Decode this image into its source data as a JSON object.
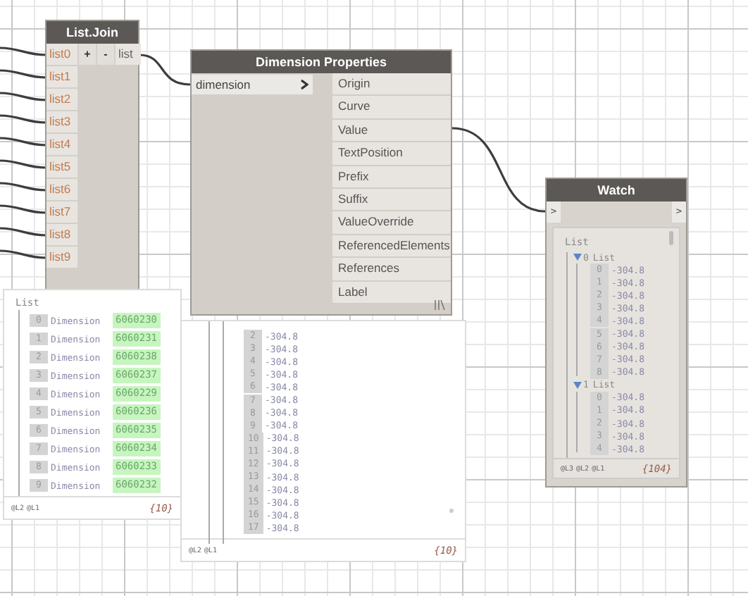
{
  "list_join": {
    "title": "List.Join",
    "inputs": [
      "list0",
      "list1",
      "list2",
      "list3",
      "list4",
      "list5",
      "list6",
      "list7",
      "list8",
      "list9"
    ],
    "buttons": [
      "+",
      "-"
    ],
    "output": "list"
  },
  "dimension_properties": {
    "title": "Dimension Properties",
    "input": "dimension",
    "outputs": [
      "Origin",
      "Curve",
      "Value",
      "TextPosition",
      "Prefix",
      "Suffix",
      "ValueOverride",
      "ReferencedElements",
      "References",
      "Label"
    ]
  },
  "elements_preview": {
    "header": "List",
    "items": [
      {
        "index": "0",
        "type": "Dimension",
        "id": "6060230"
      },
      {
        "index": "1",
        "type": "Dimension",
        "id": "6060231"
      },
      {
        "index": "2",
        "type": "Dimension",
        "id": "6060238"
      },
      {
        "index": "3",
        "type": "Dimension",
        "id": "6060237"
      },
      {
        "index": "4",
        "type": "Dimension",
        "id": "6060229"
      },
      {
        "index": "5",
        "type": "Dimension",
        "id": "6060236"
      },
      {
        "index": "6",
        "type": "Dimension",
        "id": "6060235"
      },
      {
        "index": "7",
        "type": "Dimension",
        "id": "6060234"
      },
      {
        "index": "8",
        "type": "Dimension",
        "id": "6060233"
      },
      {
        "index": "9",
        "type": "Dimension",
        "id": "6060232"
      }
    ],
    "levels": [
      "@L2",
      "@L1"
    ],
    "count": "{10}"
  },
  "values_preview": {
    "items": [
      {
        "index": "2",
        "value": "-304.8"
      },
      {
        "index": "3",
        "value": "-304.8"
      },
      {
        "index": "4",
        "value": "-304.8"
      },
      {
        "index": "5",
        "value": "-304.8"
      },
      {
        "index": "6",
        "value": "-304.8"
      },
      {
        "index": "7",
        "value": "-304.8"
      },
      {
        "index": "8",
        "value": "-304.8"
      },
      {
        "index": "9",
        "value": "-304.8"
      },
      {
        "index": "10",
        "value": "-304.8"
      },
      {
        "index": "11",
        "value": "-304.8"
      },
      {
        "index": "12",
        "value": "-304.8"
      },
      {
        "index": "13",
        "value": "-304.8"
      },
      {
        "index": "14",
        "value": "-304.8"
      },
      {
        "index": "15",
        "value": "-304.8"
      },
      {
        "index": "16",
        "value": "-304.8"
      },
      {
        "index": "17",
        "value": "-304.8"
      }
    ],
    "levels": [
      "@L2",
      "@L1"
    ],
    "count": "{10}"
  },
  "watch": {
    "title": "Watch",
    "input": ">",
    "output": ">",
    "header": "List",
    "children": [
      {
        "index": "0",
        "label": "List",
        "expanded": true,
        "items": [
          {
            "index": "0",
            "value": "-304.8"
          },
          {
            "index": "1",
            "value": "-304.8"
          },
          {
            "index": "2",
            "value": "-304.8"
          },
          {
            "index": "3",
            "value": "-304.8"
          },
          {
            "index": "4",
            "value": "-304.8"
          },
          {
            "index": "5",
            "value": "-304.8"
          },
          {
            "index": "6",
            "value": "-304.8"
          },
          {
            "index": "7",
            "value": "-304.8"
          },
          {
            "index": "8",
            "value": "-304.8"
          }
        ]
      },
      {
        "index": "1",
        "label": "List",
        "expanded": true,
        "items": [
          {
            "index": "0",
            "value": "-304.8"
          },
          {
            "index": "1",
            "value": "-304.8"
          },
          {
            "index": "2",
            "value": "-304.8"
          },
          {
            "index": "3",
            "value": "-304.8"
          },
          {
            "index": "4",
            "value": "-304.8"
          }
        ]
      }
    ],
    "levels": [
      "@L3",
      "@L2",
      "@L1"
    ],
    "count": "{104}"
  }
}
